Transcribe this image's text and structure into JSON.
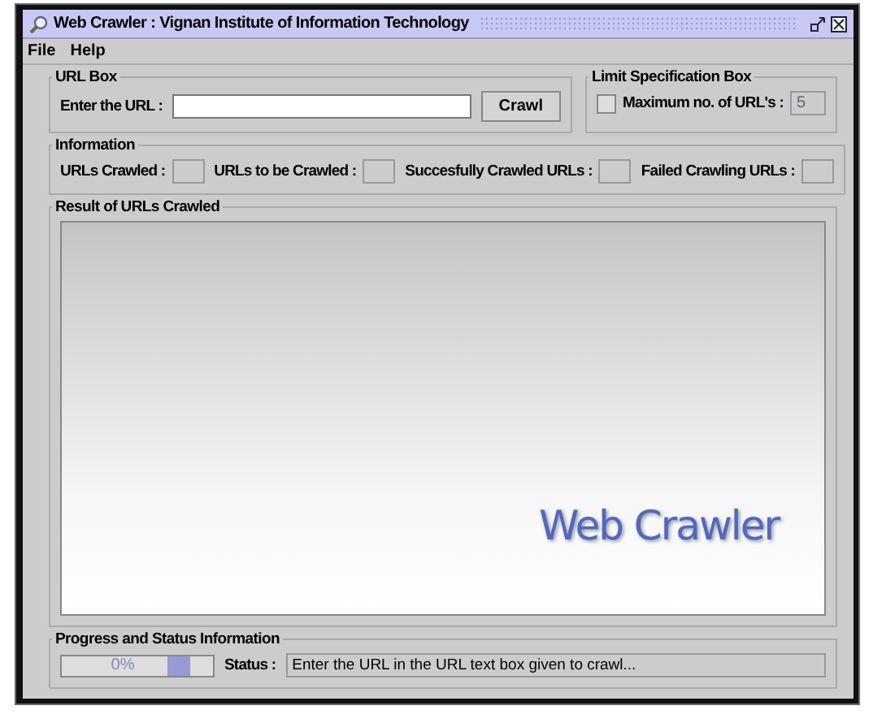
{
  "window": {
    "title": "Web Crawler : Vignan Institute of Information Technology"
  },
  "menu": [
    "File",
    "Help"
  ],
  "url_box": {
    "title": "URL Box",
    "label": "Enter the URL :",
    "button": "Crawl"
  },
  "limit_box": {
    "title": "Limit Specification Box",
    "label": "Maximum no. of URL's :",
    "checked": false,
    "value": "5"
  },
  "information": {
    "title": "Information",
    "fields": [
      {
        "label": "URLs Crawled :"
      },
      {
        "label": "URLs to be Crawled :"
      },
      {
        "label": "Succesfully Crawled URLs :"
      },
      {
        "label": "Failed Crawling URLs :"
      }
    ]
  },
  "result": {
    "title": "Result of URLs Crawled",
    "logo_text": "Web Crawler"
  },
  "progress": {
    "title": "Progress and Status Information",
    "text": "0%",
    "indeterminate": true,
    "status_label": "Status :",
    "status_text": "Enter the URL in the URL text box given to crawl..."
  }
}
